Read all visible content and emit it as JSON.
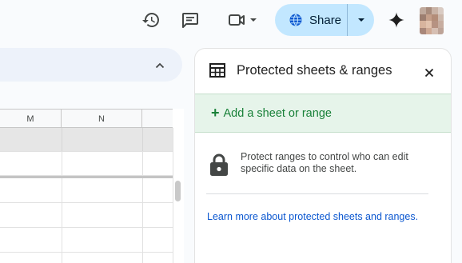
{
  "toolbar": {
    "history_icon": "history-icon",
    "comment_icon": "comment-icon",
    "meet_icon": "video-camera-icon",
    "share_label": "Share",
    "share_icon": "globe-icon",
    "gemini_icon": "sparkle-icon",
    "share_bg": "#c2e7ff"
  },
  "grid": {
    "columns": [
      "M",
      "N",
      ""
    ]
  },
  "panel": {
    "title": "Protected sheets & ranges",
    "add_label": "Add a sheet or range",
    "add_color": "#188038",
    "info_text": "Protect ranges to control who can edit specific data on the sheet.",
    "learn_more": "Learn more about protected sheets and ranges.",
    "link_color": "#0b57d0"
  }
}
